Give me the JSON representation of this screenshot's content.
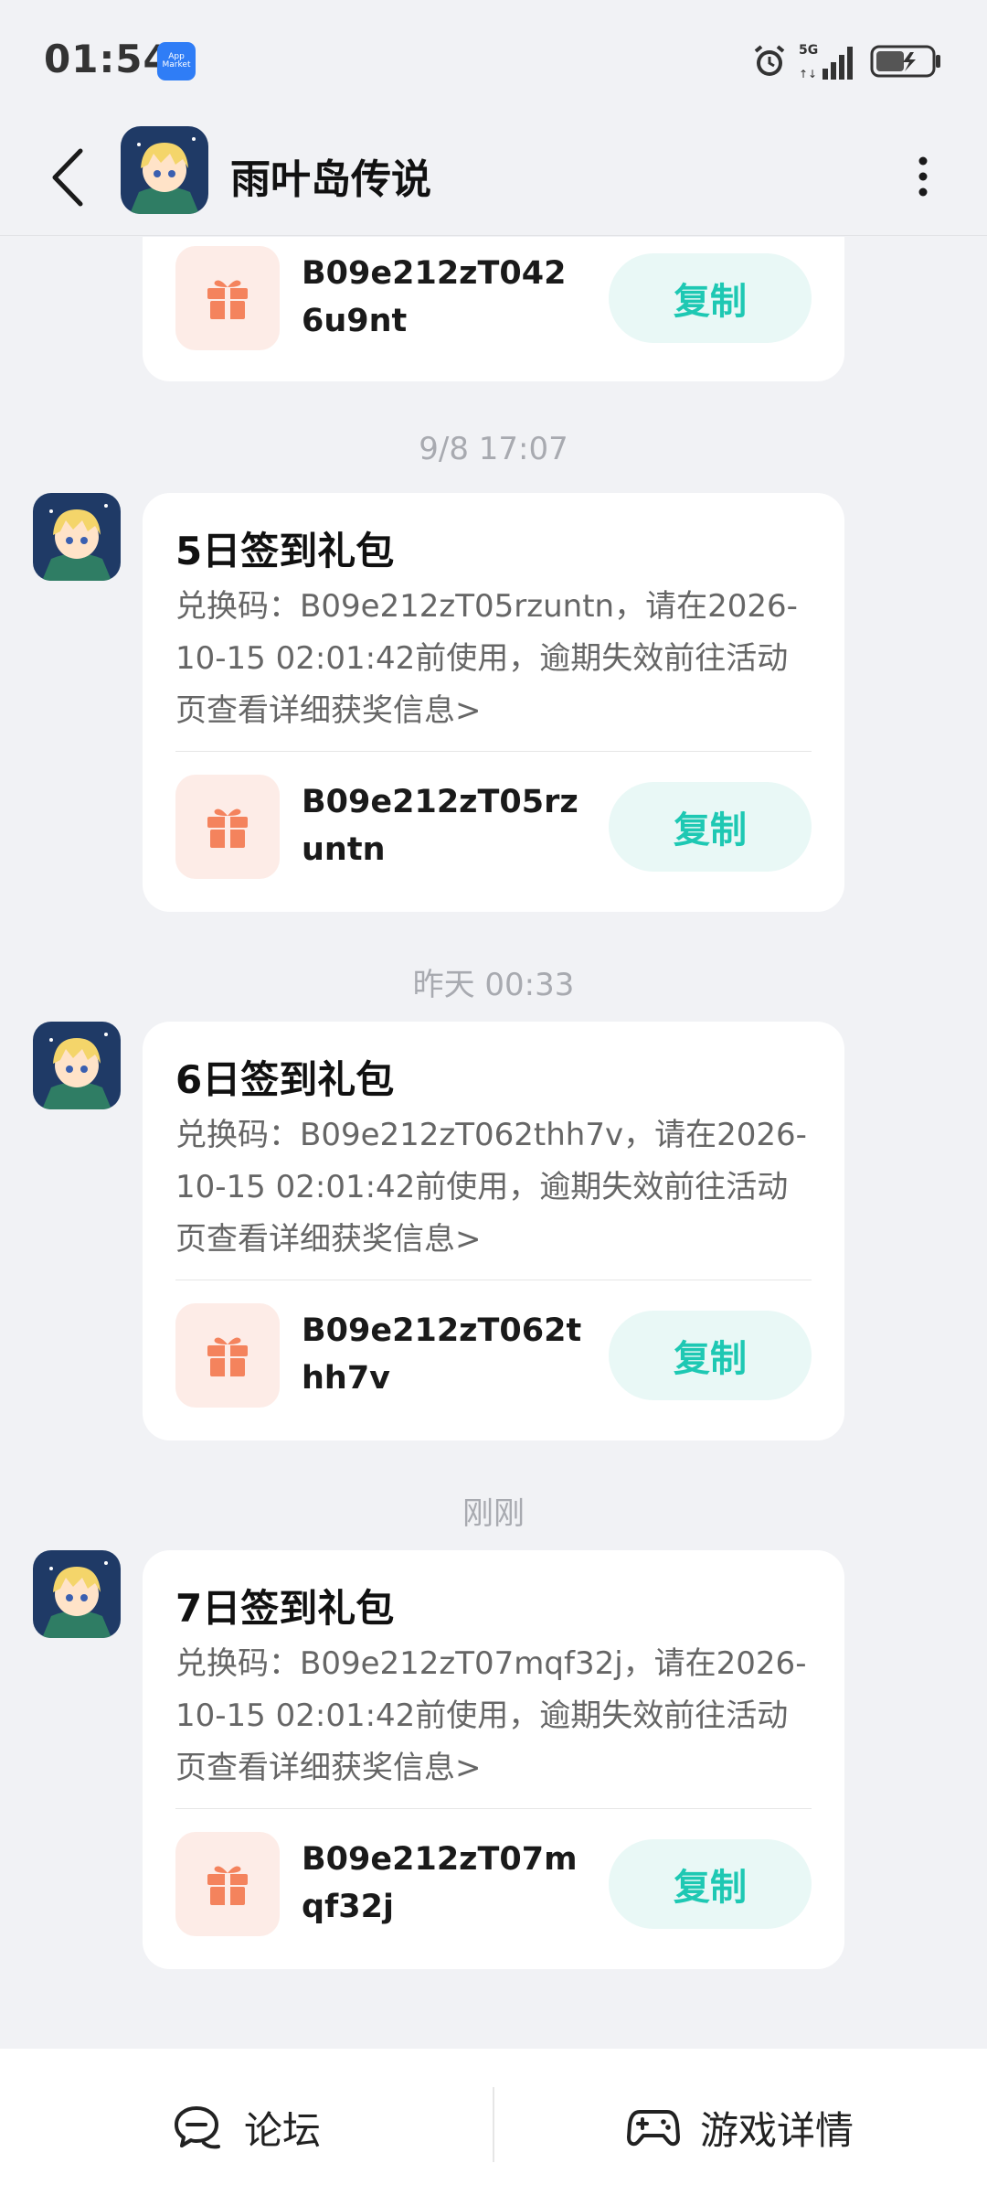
{
  "status_bar": {
    "time": "01:54",
    "app_icon": "app-market-icon",
    "app_icon_text": "App Market",
    "network": "5G"
  },
  "header": {
    "title": "雨叶岛传说",
    "back_icon": "chevron-left-icon",
    "more_icon": "more-vertical-icon"
  },
  "messages": [
    {
      "partial": true,
      "code": "B09e212zT0426u9nt",
      "copy_label": "复制"
    },
    {
      "timestamp": "9/8  17:07",
      "title": "5日签到礼包",
      "description": "兑换码：B09e212zT05rzuntn，请在2026-10-15 02:01:42前使用，逾期失效前往活动页查看详细获奖信息>",
      "code": "B09e212zT05rzuntn",
      "copy_label": "复制"
    },
    {
      "timestamp": "昨天  00:33",
      "title": "6日签到礼包",
      "description": "兑换码：B09e212zT062thh7v，请在2026-10-15 02:01:42前使用，逾期失效前往活动页查看详细获奖信息>",
      "code": "B09e212zT062thh7v",
      "copy_label": "复制"
    },
    {
      "timestamp": "刚刚",
      "title": "7日签到礼包",
      "description": "兑换码：B09e212zT07mqf32j，请在2026-10-15 02:01:42前使用，逾期失效前往活动页查看详细获奖信息>",
      "code": "B09e212zT07mqf32j",
      "copy_label": "复制"
    }
  ],
  "bottom_bar": {
    "forum_label": "论坛",
    "game_details_label": "游戏详情"
  },
  "colors": {
    "accent": "#1ec8b3",
    "gift": "#f4835d",
    "background": "#f1f2f5"
  }
}
